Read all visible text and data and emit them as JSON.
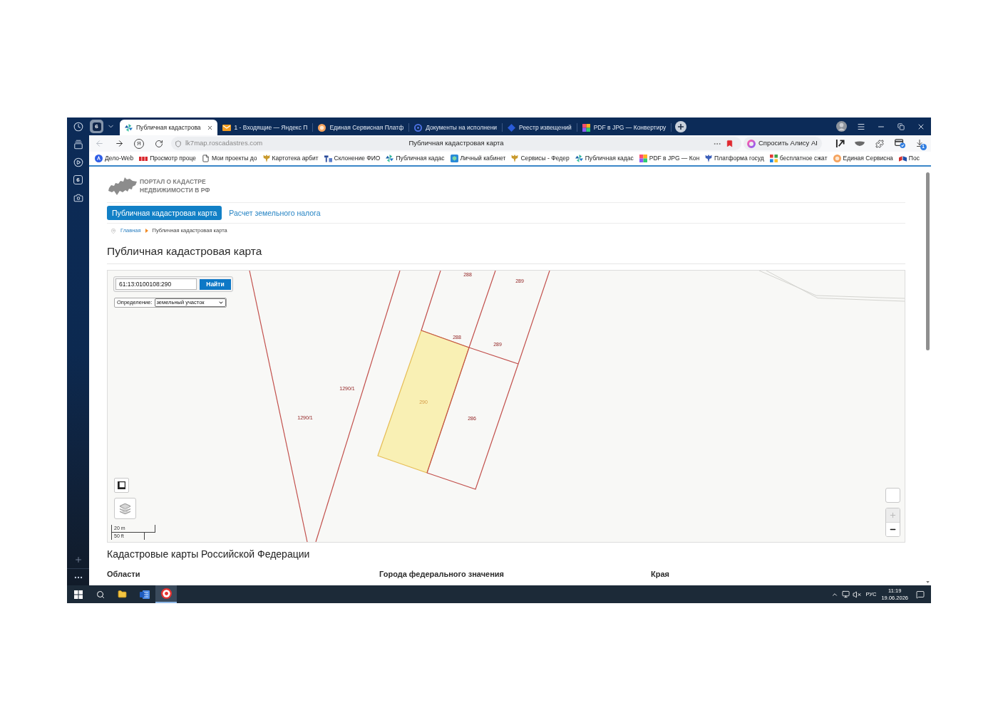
{
  "sidebar": {
    "tab_count": "6"
  },
  "tab_bar": {
    "tab_count": "6",
    "tabs": [
      {
        "title": "Публичная кадастрова",
        "selected": true
      },
      {
        "title": "1 - Входящие — Яндекс П",
        "selected": false
      },
      {
        "title": "Единая Сервисная Платф",
        "selected": false
      },
      {
        "title": "Документы на исполнени",
        "selected": false
      },
      {
        "title": "Реестр извещений",
        "selected": false
      },
      {
        "title": "PDF в JPG — Конвертиру",
        "selected": false
      }
    ]
  },
  "address_bar": {
    "back_button": {
      "disabled": true
    },
    "yandex_button": "Я",
    "url": "lk7map.roscadastres.com",
    "page_title": "Публичная кадастровая карта",
    "alice_button": "Спросить Алису AI",
    "downloads_badge": "1"
  },
  "bookmarks": [
    "Дело-Web",
    "Просмотр проце",
    "Мои проекты до",
    "Картотека арбит",
    "Склонение ФИО",
    "Публичная кадас",
    "Личный кабинет",
    "Сервисы - Федер",
    "Публичная кадас",
    "PDF в JPG — Кон",
    "Платформа госуд",
    "бесплатное сжат",
    "Единая Сервисна",
    "Пос"
  ],
  "page": {
    "logo_text": [
      "ПОРТАЛ О КАДАСТРЕ",
      "НЕДВИЖИМОСТИ В РФ"
    ],
    "nav_tabs": [
      {
        "label": "Публичная кадастровая карта",
        "selected": true
      },
      {
        "label": "Расчет земельного налога",
        "selected": false
      }
    ],
    "breadcrumb": [
      {
        "label": "Главная",
        "kind": "link"
      },
      {
        "label": "Публичная кадастровая карта",
        "kind": "current"
      }
    ],
    "heading": "Публичная кадастровая карта",
    "map": {
      "search": {
        "value": "61:13:0100108:290",
        "button": "Найти"
      },
      "definition": {
        "label": "Определение:",
        "value": "земельный участок"
      },
      "parcels": [
        {
          "label": "288",
          "selected": false
        },
        {
          "label": "289",
          "selected": false
        },
        {
          "label": "288",
          "selected": false
        },
        {
          "label": "289",
          "selected": false
        },
        {
          "label": "1290/1",
          "selected": false
        },
        {
          "label": "290",
          "selected": true
        },
        {
          "label": "1290/1",
          "selected": false
        },
        {
          "label": "286",
          "selected": false
        }
      ],
      "scale": [
        "20 m",
        "50 ft"
      ],
      "zoom_in": {
        "disabled": true
      },
      "zoom_out": {
        "disabled": false
      }
    },
    "section_title": "Кадастровые карты Российской Федерации",
    "columns": [
      "Области",
      "Города федерального значения",
      "Края"
    ]
  },
  "taskbar": {
    "pinned_apps": [
      {
        "selected": false
      },
      {
        "selected": false
      },
      {
        "selected": true
      }
    ],
    "language": "РУС",
    "time": "11:19",
    "date": "19.06.2026"
  }
}
